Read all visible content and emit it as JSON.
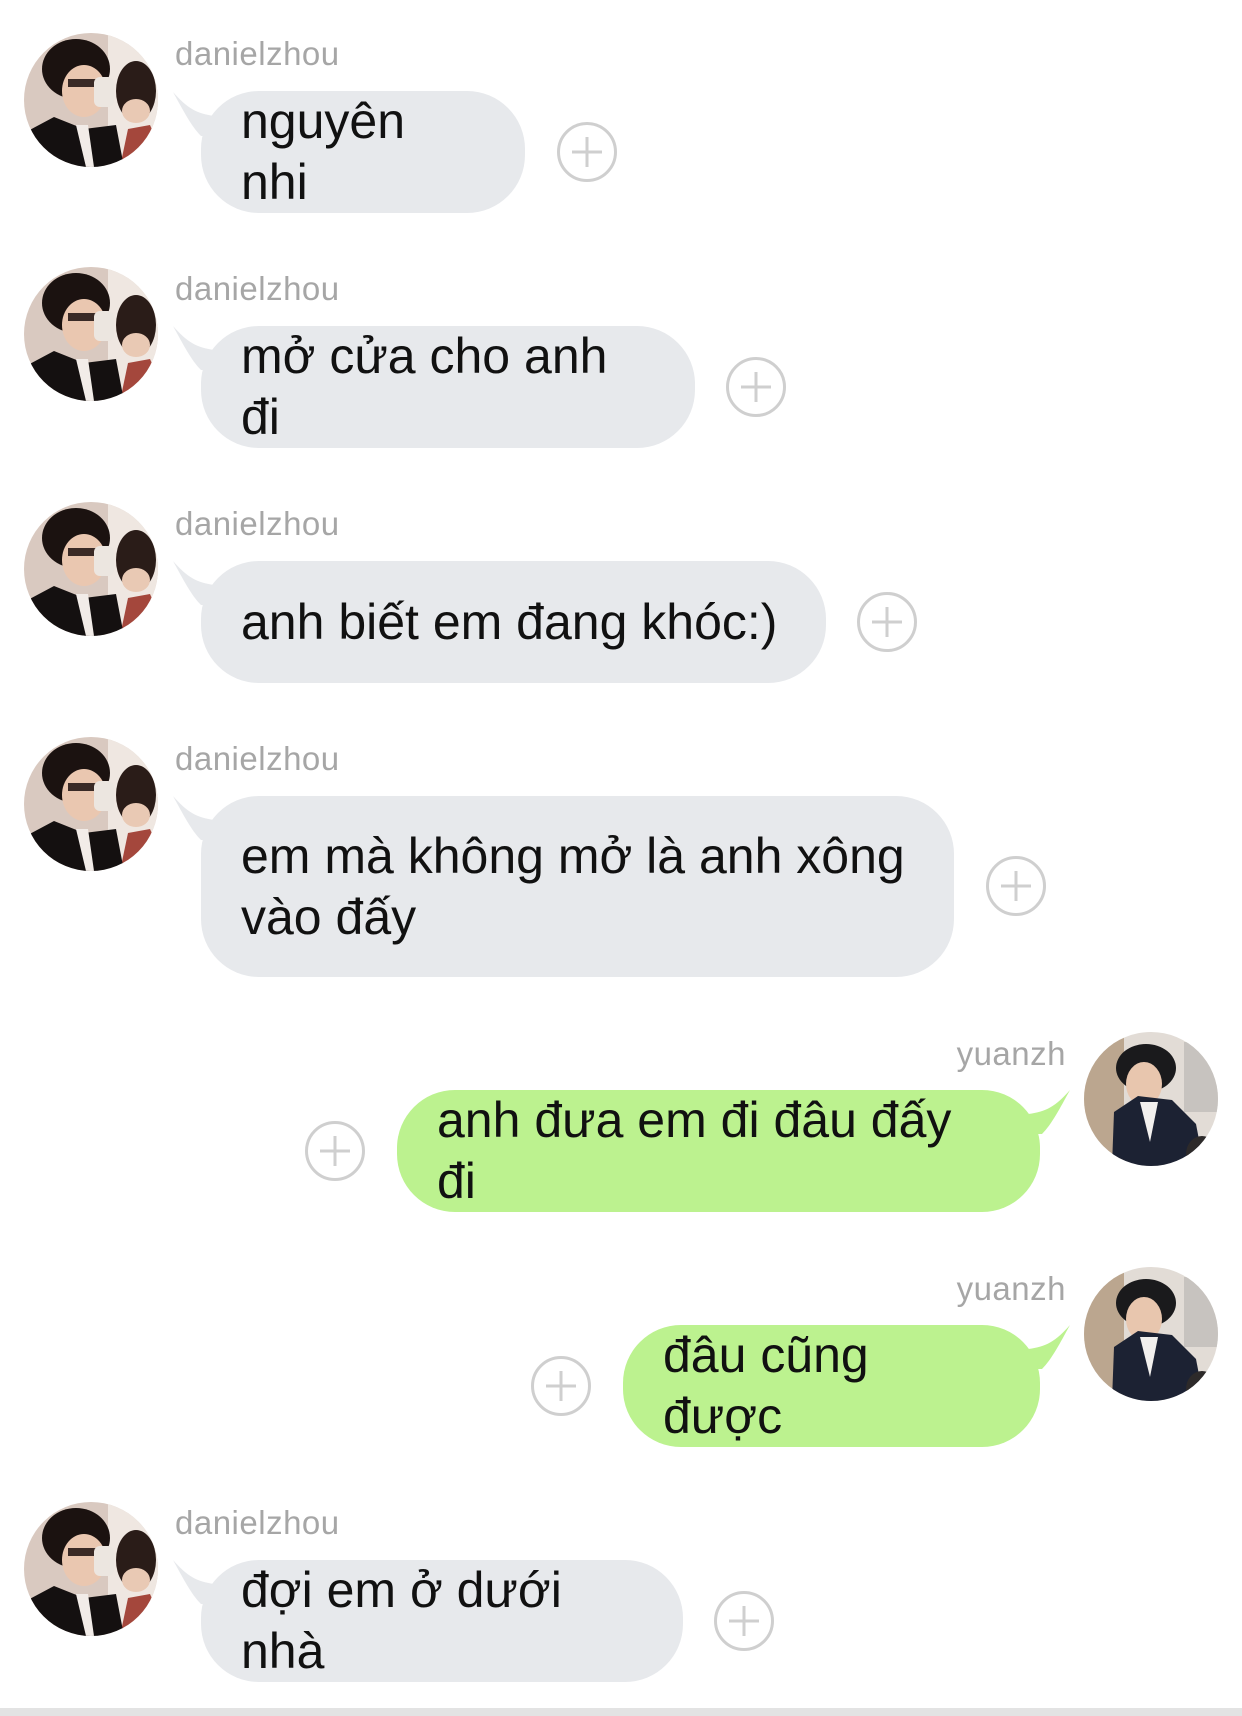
{
  "messages": [
    {
      "sender": "danielzhou",
      "direction": "in",
      "text": "nguyên nhi"
    },
    {
      "sender": "danielzhou",
      "direction": "in",
      "text": "mở cửa cho anh đi"
    },
    {
      "sender": "danielzhou",
      "direction": "in",
      "text": "anh biết em đang khóc:)"
    },
    {
      "sender": "danielzhou",
      "direction": "in",
      "text": "em mà không mở là anh xông\nvào đấy"
    },
    {
      "sender": "yuanzh",
      "direction": "out",
      "text": "anh đưa em đi đâu đấy đi"
    },
    {
      "sender": "yuanzh",
      "direction": "out",
      "text": "đâu cũng được"
    },
    {
      "sender": "danielzhou",
      "direction": "in",
      "text": "đợi em ở dưới nhà"
    }
  ],
  "colors": {
    "incoming_bubble": "#e7e9ec",
    "outgoing_bubble": "#bcf28f",
    "username": "#a6a6a6",
    "add_reaction_icon": "#cfcfcf"
  },
  "icons": {
    "add_reaction": "plus-circle-icon",
    "avatar": "profile-photo"
  }
}
